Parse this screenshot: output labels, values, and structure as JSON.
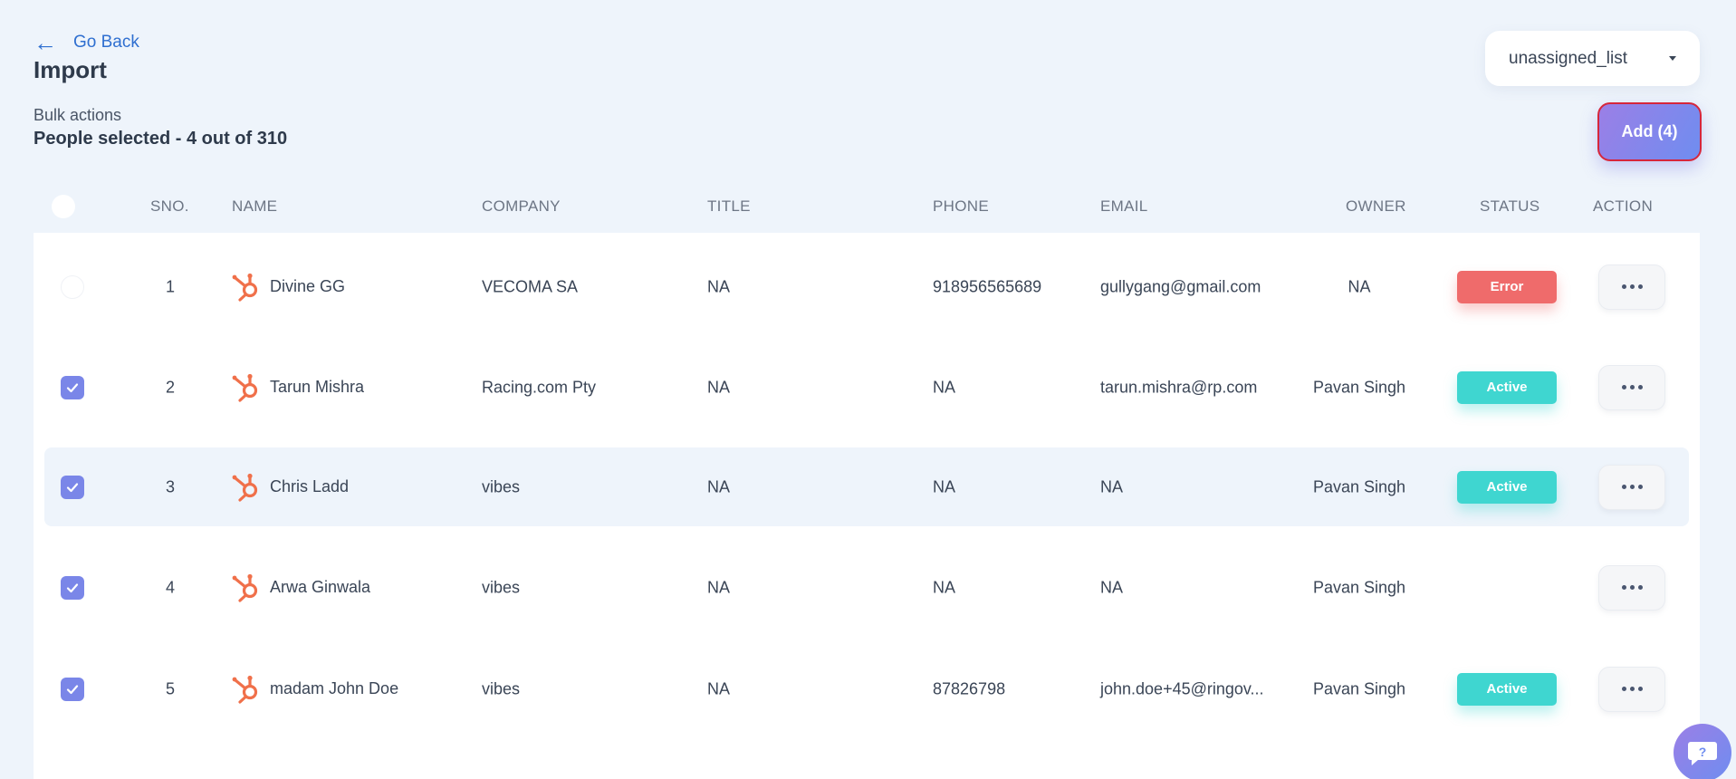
{
  "nav": {
    "back_label": "Go Back",
    "back_icon": "arrow-left-icon"
  },
  "page": {
    "title": "Import",
    "bulk_actions_label": "Bulk actions",
    "selected_text": "People selected - 4 out of 310"
  },
  "list_select": {
    "value": "unassigned_list"
  },
  "add_button": {
    "label": "Add (4)"
  },
  "table": {
    "columns": {
      "sno": "SNO.",
      "name": "NAME",
      "company": "COMPANY",
      "title": "TITLE",
      "phone": "PHONE",
      "email": "EMAIL",
      "owner": "OWNER",
      "status": "STATUS",
      "action": "ACTION"
    },
    "rows": [
      {
        "checked": false,
        "sno": "1",
        "name": "Divine GG",
        "company": "VECOMA SA",
        "title": "NA",
        "phone": "918956565689",
        "email": "gullygang@gmail.com",
        "owner": "NA",
        "status": "Error"
      },
      {
        "checked": true,
        "sno": "2",
        "name": "Tarun Mishra",
        "company": "Racing.com Pty",
        "title": "NA",
        "phone": "NA",
        "email": "tarun.mishra@rp.com",
        "owner": "Pavan Singh",
        "status": "Active"
      },
      {
        "checked": true,
        "sno": "3",
        "name": "Chris Ladd",
        "company": "vibes",
        "title": "NA",
        "phone": "NA",
        "email": "NA",
        "owner": "Pavan Singh",
        "status": "Active"
      },
      {
        "checked": true,
        "sno": "4",
        "name": "Arwa Ginwala",
        "company": "vibes",
        "title": "NA",
        "phone": "NA",
        "email": "NA",
        "owner": "Pavan Singh",
        "status": ""
      },
      {
        "checked": true,
        "sno": "5",
        "name": "madam John Doe",
        "company": "vibes",
        "title": "NA",
        "phone": "87826798",
        "email": "john.doe+45@ringov...",
        "owner": "Pavan Singh",
        "status": "Active"
      }
    ]
  },
  "colors": {
    "accent": "#2f6fd0",
    "checkbox": "#7a86e8",
    "error": "#ef6b6b",
    "active": "#3fd6d0",
    "hubspot": "#f0704a"
  },
  "icons": {
    "row_source": "hubspot-icon",
    "action": "more-horizontal-icon",
    "help": "help-chat-icon"
  }
}
